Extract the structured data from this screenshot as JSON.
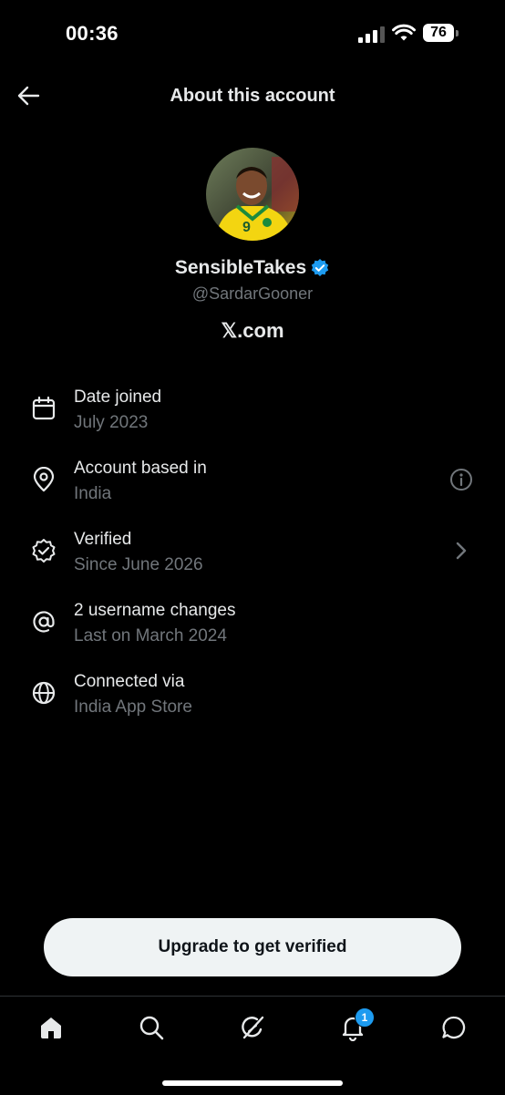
{
  "status_bar": {
    "time": "00:36",
    "battery": "76"
  },
  "header": {
    "title": "About this account"
  },
  "profile": {
    "display_name": "SensibleTakes",
    "handle": "@SardarGooner",
    "site": "𝕏.com",
    "jersey_number": "9",
    "verified_color": "#1d9bf0"
  },
  "info_items": [
    {
      "icon": "calendar-icon",
      "title": "Date joined",
      "subtitle": "July 2023"
    },
    {
      "icon": "location-pin-icon",
      "title": "Account based in",
      "subtitle": "India",
      "trailing": "info-icon"
    },
    {
      "icon": "verified-check-icon",
      "title": "Verified",
      "subtitle": "Since June 2026",
      "trailing": "chevron-right-icon"
    },
    {
      "icon": "at-sign-icon",
      "title": "2 username changes",
      "subtitle": "Last on March 2024"
    },
    {
      "icon": "globe-icon",
      "title": "Connected via",
      "subtitle": "India App Store"
    }
  ],
  "cta": {
    "label": "Upgrade to get verified"
  },
  "tab_bar": {
    "tabs": [
      "home-icon",
      "search-icon",
      "grok-icon",
      "notifications-icon",
      "messages-icon"
    ],
    "notification_count": "1"
  },
  "colors": {
    "background": "#000000",
    "text": "#e7e9ea",
    "secondary": "#71767b",
    "accent": "#1d9bf0",
    "button": "#eff3f4"
  }
}
